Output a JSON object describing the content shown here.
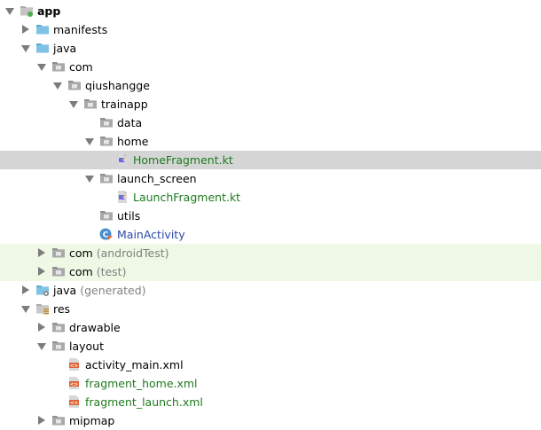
{
  "tree": {
    "rows": [
      {
        "label": "app",
        "suffix": "",
        "icon": "module-folder-icon",
        "arrow": "expanded",
        "style": "bold",
        "state": ""
      },
      {
        "label": "manifests",
        "suffix": "",
        "icon": "manifest-folder-icon",
        "arrow": "collapsed",
        "style": "plain",
        "state": ""
      },
      {
        "label": "java",
        "suffix": "",
        "icon": "source-folder-icon",
        "arrow": "expanded",
        "style": "plain",
        "state": ""
      },
      {
        "label": "com",
        "suffix": "",
        "icon": "package-icon",
        "arrow": "expanded",
        "style": "plain",
        "state": ""
      },
      {
        "label": "qiushangge",
        "suffix": "",
        "icon": "package-icon",
        "arrow": "expanded",
        "style": "plain",
        "state": ""
      },
      {
        "label": "trainapp",
        "suffix": "",
        "icon": "package-icon",
        "arrow": "expanded",
        "style": "plain",
        "state": ""
      },
      {
        "label": "data",
        "suffix": "",
        "icon": "package-icon",
        "arrow": "none",
        "style": "plain",
        "state": ""
      },
      {
        "label": "home",
        "suffix": "",
        "icon": "package-icon",
        "arrow": "expanded",
        "style": "plain",
        "state": ""
      },
      {
        "label": "HomeFragment.kt",
        "suffix": "",
        "icon": "kotlin-file-icon",
        "arrow": "none",
        "style": "green",
        "state": "selected"
      },
      {
        "label": "launch_screen",
        "suffix": "",
        "icon": "package-icon",
        "arrow": "expanded",
        "style": "plain",
        "state": ""
      },
      {
        "label": "LaunchFragment.kt",
        "suffix": "",
        "icon": "kotlin-file-icon",
        "arrow": "none",
        "style": "green",
        "state": ""
      },
      {
        "label": "utils",
        "suffix": "",
        "icon": "package-icon",
        "arrow": "none",
        "style": "plain",
        "state": ""
      },
      {
        "label": "MainActivity",
        "suffix": "",
        "icon": "kotlin-class-icon",
        "arrow": "none",
        "style": "blue",
        "state": ""
      },
      {
        "label": "com",
        "suffix": "(androidTest)",
        "icon": "package-icon",
        "arrow": "collapsed",
        "style": "plain",
        "state": "test"
      },
      {
        "label": "com",
        "suffix": "(test)",
        "icon": "package-icon",
        "arrow": "collapsed",
        "style": "plain",
        "state": "test"
      },
      {
        "label": "java",
        "suffix": "(generated)",
        "icon": "generated-source-folder-icon",
        "arrow": "collapsed",
        "style": "plain",
        "state": ""
      },
      {
        "label": "res",
        "suffix": "",
        "icon": "resource-folder-icon",
        "arrow": "expanded",
        "style": "plain",
        "state": ""
      },
      {
        "label": "drawable",
        "suffix": "",
        "icon": "folder-icon",
        "arrow": "collapsed",
        "style": "plain",
        "state": ""
      },
      {
        "label": "layout",
        "suffix": "",
        "icon": "folder-icon",
        "arrow": "expanded",
        "style": "plain",
        "state": ""
      },
      {
        "label": "activity_main.xml",
        "suffix": "",
        "icon": "xml-file-icon",
        "arrow": "none",
        "style": "plain",
        "state": ""
      },
      {
        "label": "fragment_home.xml",
        "suffix": "",
        "icon": "xml-file-icon",
        "arrow": "none",
        "style": "green",
        "state": ""
      },
      {
        "label": "fragment_launch.xml",
        "suffix": "",
        "icon": "xml-file-icon",
        "arrow": "none",
        "style": "green",
        "state": ""
      },
      {
        "label": "mipmap",
        "suffix": "",
        "icon": "folder-icon",
        "arrow": "collapsed",
        "style": "plain",
        "state": ""
      }
    ]
  },
  "colors": {
    "selection": "#d5d5d5",
    "test_source_background": "#eef8e4",
    "modified_file_text": "#1e7b1e",
    "class_text": "#2a49a8",
    "suffix_text": "#808080",
    "folder_blue": "#7ec3e6",
    "package_gray": "#a9a9a9"
  }
}
